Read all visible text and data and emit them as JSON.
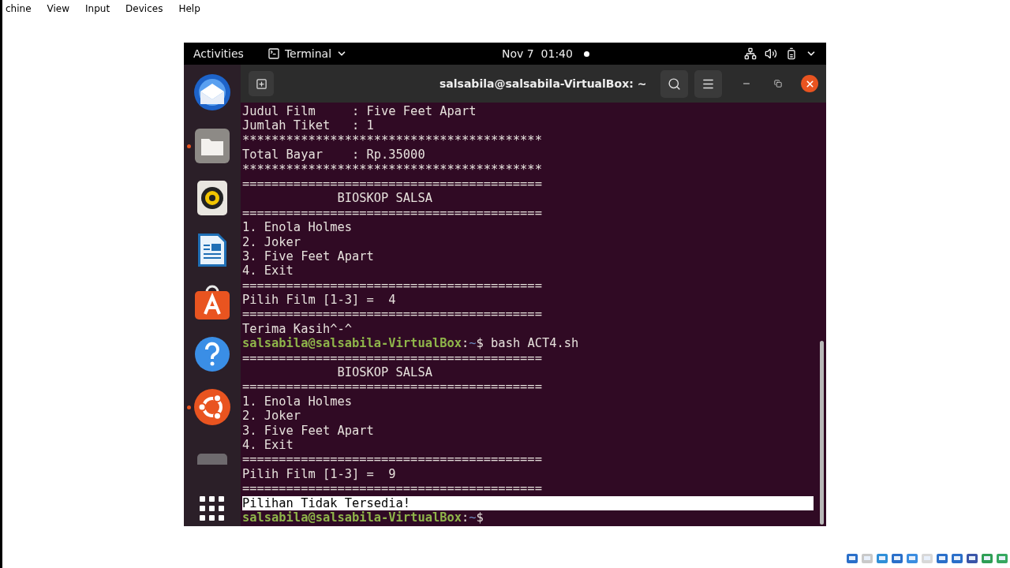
{
  "host_menu": [
    "chine",
    "View",
    "Input",
    "Devices",
    "Help"
  ],
  "top_bar": {
    "activities": "Activities",
    "app": "Terminal",
    "clock": "Nov 7  01:40"
  },
  "dock": [
    {
      "kind": "mail",
      "running": false
    },
    {
      "kind": "files",
      "running": true
    },
    {
      "kind": "music",
      "running": false
    },
    {
      "kind": "writer",
      "running": false
    },
    {
      "kind": "store",
      "running": false
    },
    {
      "kind": "help",
      "running": false
    },
    {
      "kind": "ubuntu",
      "running": true
    },
    {
      "kind": "partial",
      "running": false
    },
    {
      "kind": "grid",
      "running": false
    }
  ],
  "window": {
    "title": "salsabila@salsabila-VirtualBox: ~"
  },
  "terminal": [
    {
      "kind": "text",
      "text": "Judul Film     : Five Feet Apart"
    },
    {
      "kind": "text",
      "text": "Jumlah Tiket   : 1"
    },
    {
      "kind": "text",
      "text": "*****************************************"
    },
    {
      "kind": "text",
      "text": "Total Bayar    : Rp.35000"
    },
    {
      "kind": "text",
      "text": "*****************************************"
    },
    {
      "kind": "text",
      "text": "========================================="
    },
    {
      "kind": "text",
      "text": "             BIOSKOP SALSA"
    },
    {
      "kind": "text",
      "text": "========================================="
    },
    {
      "kind": "text",
      "text": "1. Enola Holmes"
    },
    {
      "kind": "text",
      "text": "2. Joker"
    },
    {
      "kind": "text",
      "text": "3. Five Feet Apart"
    },
    {
      "kind": "text",
      "text": "4. Exit"
    },
    {
      "kind": "text",
      "text": "========================================="
    },
    {
      "kind": "text",
      "text": "Pilih Film [1-3] =  4"
    },
    {
      "kind": "text",
      "text": "========================================="
    },
    {
      "kind": "text",
      "text": "Terima Kasih^-^"
    },
    {
      "kind": "prompt",
      "user": "salsabila@salsabila-VirtualBox",
      "colon": ":",
      "path": "~",
      "symbol": "$",
      "command": "bash ACT4.sh"
    },
    {
      "kind": "text",
      "text": "========================================="
    },
    {
      "kind": "text",
      "text": "             BIOSKOP SALSA"
    },
    {
      "kind": "text",
      "text": "========================================="
    },
    {
      "kind": "text",
      "text": "1. Enola Holmes"
    },
    {
      "kind": "text",
      "text": "2. Joker"
    },
    {
      "kind": "text",
      "text": "3. Five Feet Apart"
    },
    {
      "kind": "text",
      "text": "4. Exit"
    },
    {
      "kind": "text",
      "text": "========================================="
    },
    {
      "kind": "text",
      "text": "Pilih Film [1-3] =  9"
    },
    {
      "kind": "text",
      "text": "========================================="
    },
    {
      "kind": "highlighted",
      "text": "Pilihan Tidak Tersedia!"
    },
    {
      "kind": "prompt",
      "user": "salsabila@salsabila-VirtualBox",
      "colon": ":",
      "path": "~",
      "symbol": "$"
    }
  ]
}
